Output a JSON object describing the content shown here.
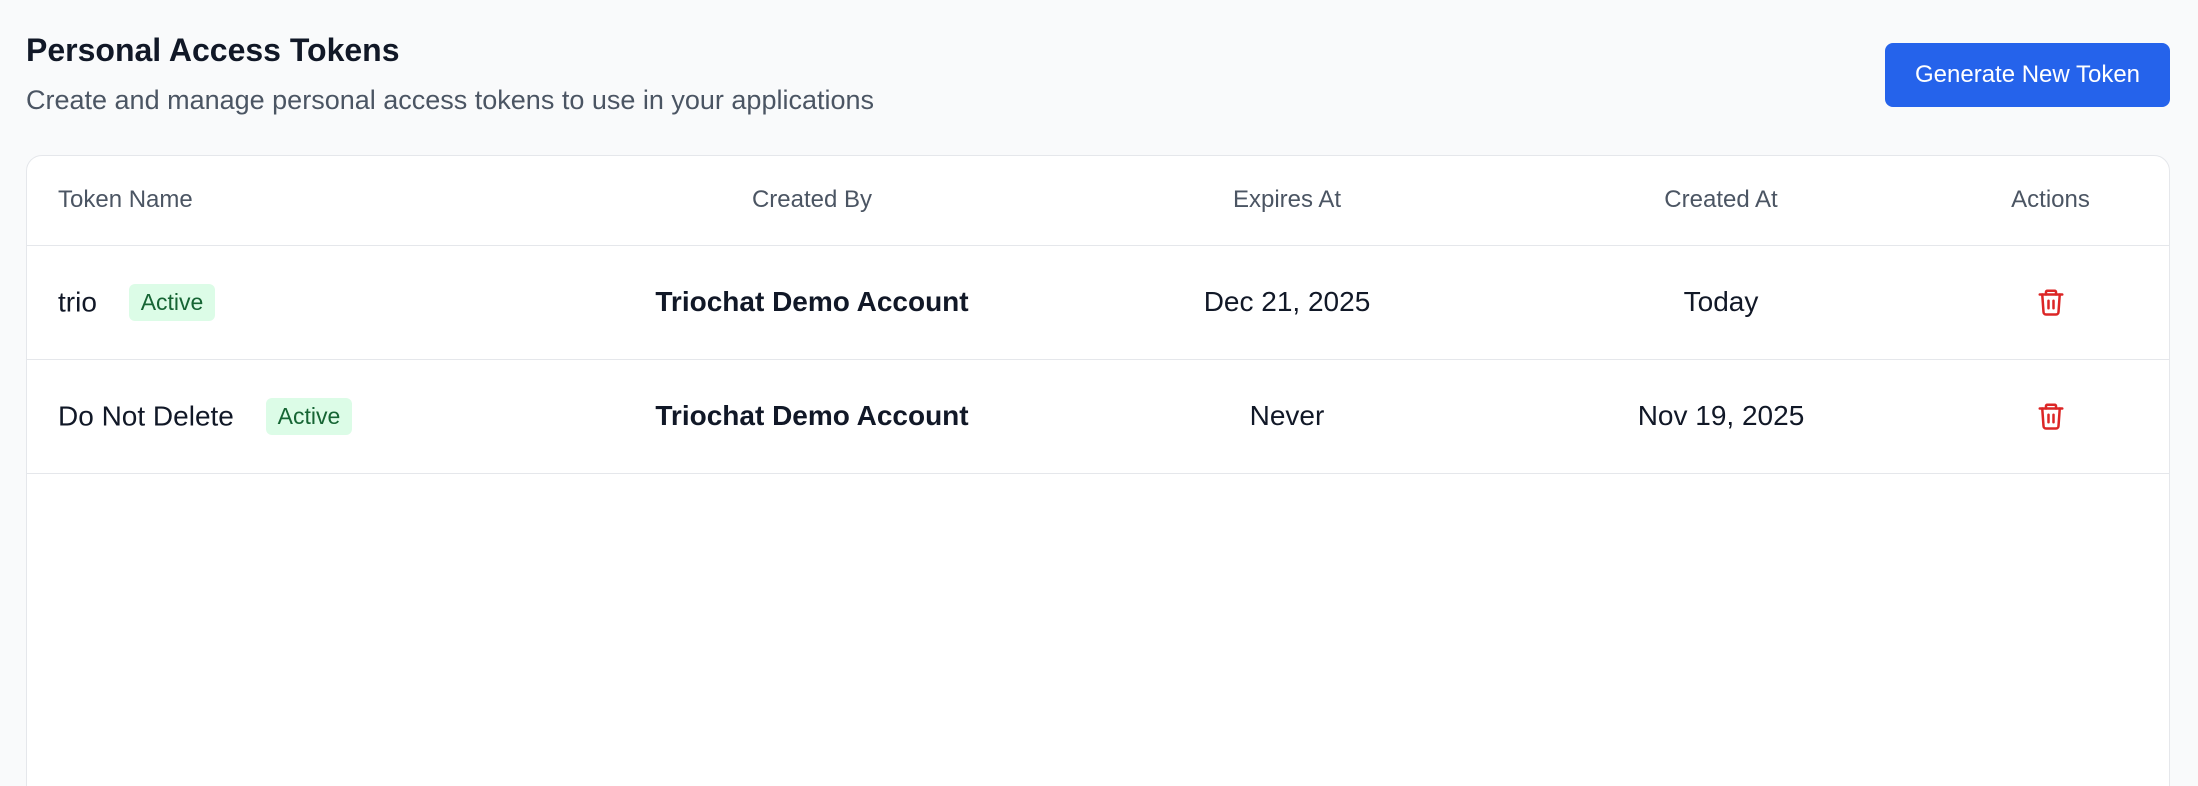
{
  "header": {
    "title": "Personal Access Tokens",
    "subtitle": "Create and manage personal access tokens to use in your applications",
    "generate_label": "Generate New Token"
  },
  "table": {
    "columns": [
      "Token Name",
      "Created By",
      "Expires At",
      "Created At",
      "Actions"
    ],
    "rows": [
      {
        "name": "trio",
        "status": "Active",
        "created_by": "Triochat Demo Account",
        "expires_at": "Dec 21, 2025",
        "created_at": "Today"
      },
      {
        "name": "Do Not Delete",
        "status": "Active",
        "created_by": "Triochat Demo Account",
        "expires_at": "Never",
        "created_at": "Nov 19, 2025"
      }
    ]
  },
  "icons": {
    "delete": "trash-icon"
  },
  "colors": {
    "accent": "#2563eb",
    "danger": "#dc2626",
    "badge_bg": "#dcfce7",
    "badge_text": "#166534"
  }
}
